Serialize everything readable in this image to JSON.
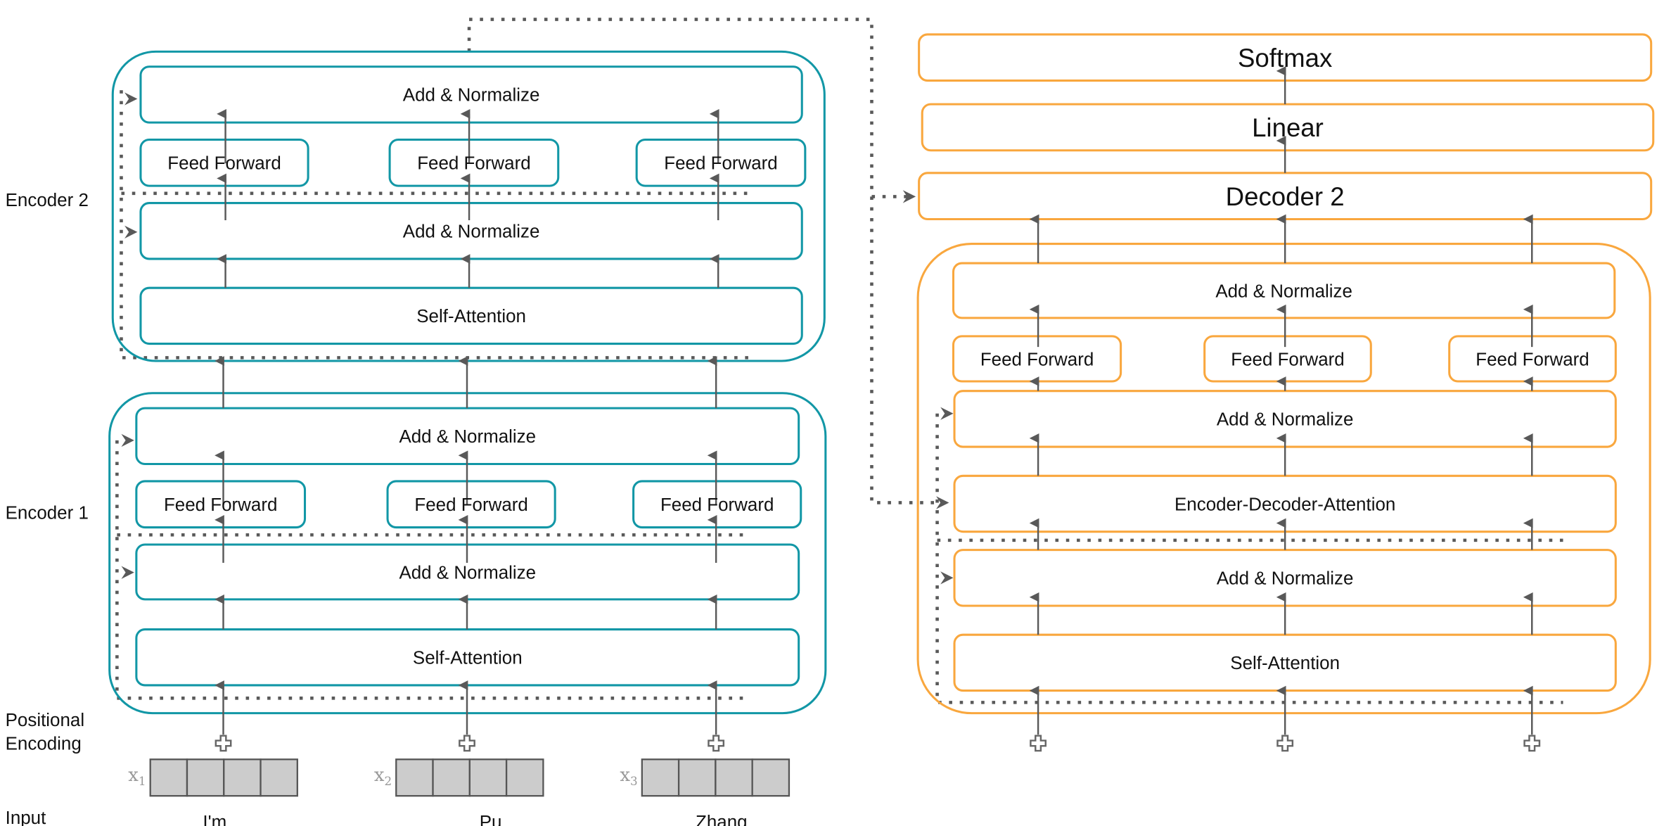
{
  "colors": {
    "encoder": "#1297a6",
    "decoder": "#f9a73e",
    "arrow": "#595959",
    "dotted": "#595959",
    "token_fill": "#cccccc"
  },
  "labels": {
    "encoder2": "Encoder 2",
    "encoder1": "Encoder 1",
    "positional_line1": "Positional",
    "positional_line2": "Encoding",
    "input": "Input"
  },
  "encoder2": {
    "top_norm": "Add & Normalize",
    "feed_forward": [
      "Feed Forward",
      "Feed Forward",
      "Feed Forward"
    ],
    "mid_norm": "Add & Normalize",
    "attention": "Self-Attention"
  },
  "encoder1": {
    "top_norm": "Add & Normalize",
    "feed_forward": [
      "Feed Forward",
      "Feed Forward",
      "Feed Forward"
    ],
    "mid_norm": "Add & Normalize",
    "attention": "Self-Attention"
  },
  "decoder": {
    "softmax": "Softmax",
    "linear": "Linear",
    "decoder2": "Decoder 2",
    "top_norm": "Add & Normalize",
    "feed_forward": [
      "Feed Forward",
      "Feed Forward",
      "Feed Forward"
    ],
    "norm2": "Add & Normalize",
    "enc_dec_attention": "Encoder-Decoder-Attention",
    "norm1": "Add & Normalize",
    "attention": "Self-Attention"
  },
  "inputs": [
    {
      "symbol": "x",
      "index": "1",
      "word": "I'm"
    },
    {
      "symbol": "x",
      "index": "2",
      "word": "Pu"
    },
    {
      "symbol": "x",
      "index": "3",
      "word": "Zhang"
    }
  ],
  "icons": {
    "plus": "plus-icon",
    "arrow": "arrow-up-icon",
    "skip": "residual-arrow-icon"
  }
}
